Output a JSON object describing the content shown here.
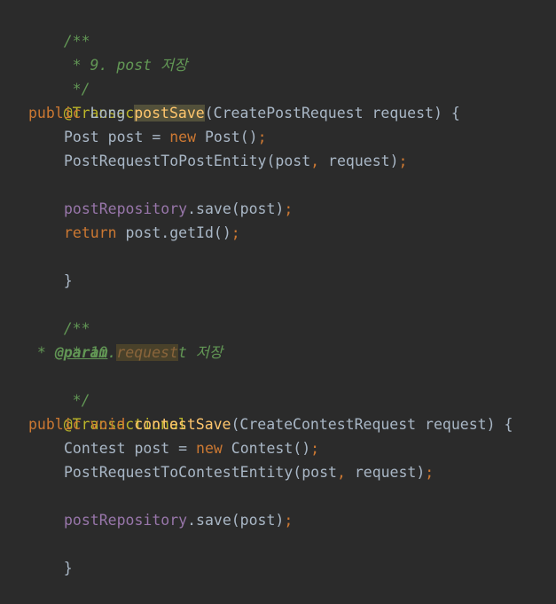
{
  "code": {
    "c1_open": "/**",
    "c1_body": " * 9. post 저장",
    "c1_close": " */",
    "anno1": "@Transactional",
    "m1": {
      "public": "public",
      "type": " Long ",
      "name": "postSave",
      "params": "(CreatePostRequest request) {"
    },
    "l1": {
      "type": "Post post = ",
      "new": "new",
      "rest": " Post()",
      "semi": ";"
    },
    "l2": {
      "text": "PostRequestToPostEntity(post",
      "comma": ",",
      "rest": " request)",
      "semi": ";"
    },
    "l3": {
      "field": "postRepository",
      "rest": ".save(post)",
      "semi": ";"
    },
    "l4": {
      "ret": "return",
      "rest": " post.getId()",
      "semi": ";"
    },
    "close1": "}",
    "c2_open": "/**",
    "c2_body": " * 10. contest 저장",
    "c2_param_prefix": " * ",
    "c2_param_tag": "@param",
    "c2_param_name": "request",
    "c2_close": " */",
    "anno2": "@Transactional",
    "m2": {
      "public": "public",
      "void": " void ",
      "name": "contestSave",
      "params": "(CreateContestRequest request) {"
    },
    "l5": {
      "type": "Contest post = ",
      "new": "new",
      "rest": " Contest()",
      "semi": ";"
    },
    "l6": {
      "text": "PostRequestToContestEntity(post",
      "comma": ",",
      "rest": " request)",
      "semi": ";"
    },
    "l7": {
      "field": "postRepository",
      "rest": ".save(post)",
      "semi": ";"
    },
    "close2": "}"
  },
  "colors": {
    "background": "#2b2b2b",
    "doc_comment": "#629755",
    "annotation": "#bbb529",
    "keyword": "#cc7832",
    "function": "#ffc66d",
    "field": "#9876aa",
    "text": "#a9b7c6"
  }
}
